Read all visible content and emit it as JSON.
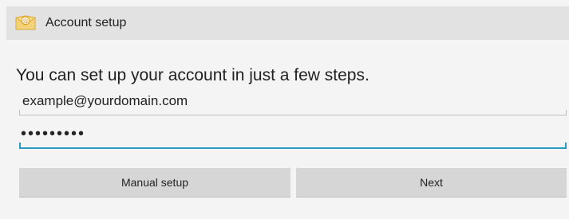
{
  "window": {
    "title": "Account setup",
    "icon": "email-app-icon"
  },
  "main": {
    "intro_text": "You can set up your account in just a few steps.",
    "email": {
      "value": "example@yourdomain.com"
    },
    "password": {
      "masked_value": "•••••••••"
    }
  },
  "buttons": {
    "manual_setup_label": "Manual setup",
    "next_label": "Next"
  },
  "colors": {
    "accent": "#2a9bc2",
    "titlebar": "#e2e2e2",
    "button": "#d6d6d6",
    "background": "#f4f4f4"
  }
}
